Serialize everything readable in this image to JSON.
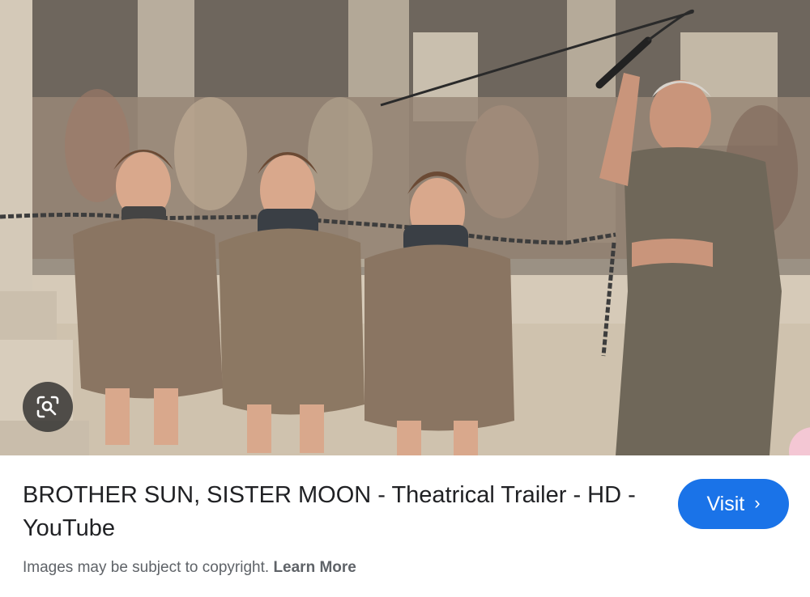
{
  "result": {
    "title": "BROTHER SUN, SISTER MOON - Theatrical Trailer - HD - YouTube",
    "visit_label": "Visit",
    "visit_icon": "chevron-right-icon",
    "lens_icon": "lens-search-icon"
  },
  "footer": {
    "notice": "Images may be subject to copyright.",
    "learn_more": "Learn More"
  },
  "colors": {
    "accent": "#1a73e8",
    "title_text": "#202124",
    "muted_text": "#5f6368"
  }
}
